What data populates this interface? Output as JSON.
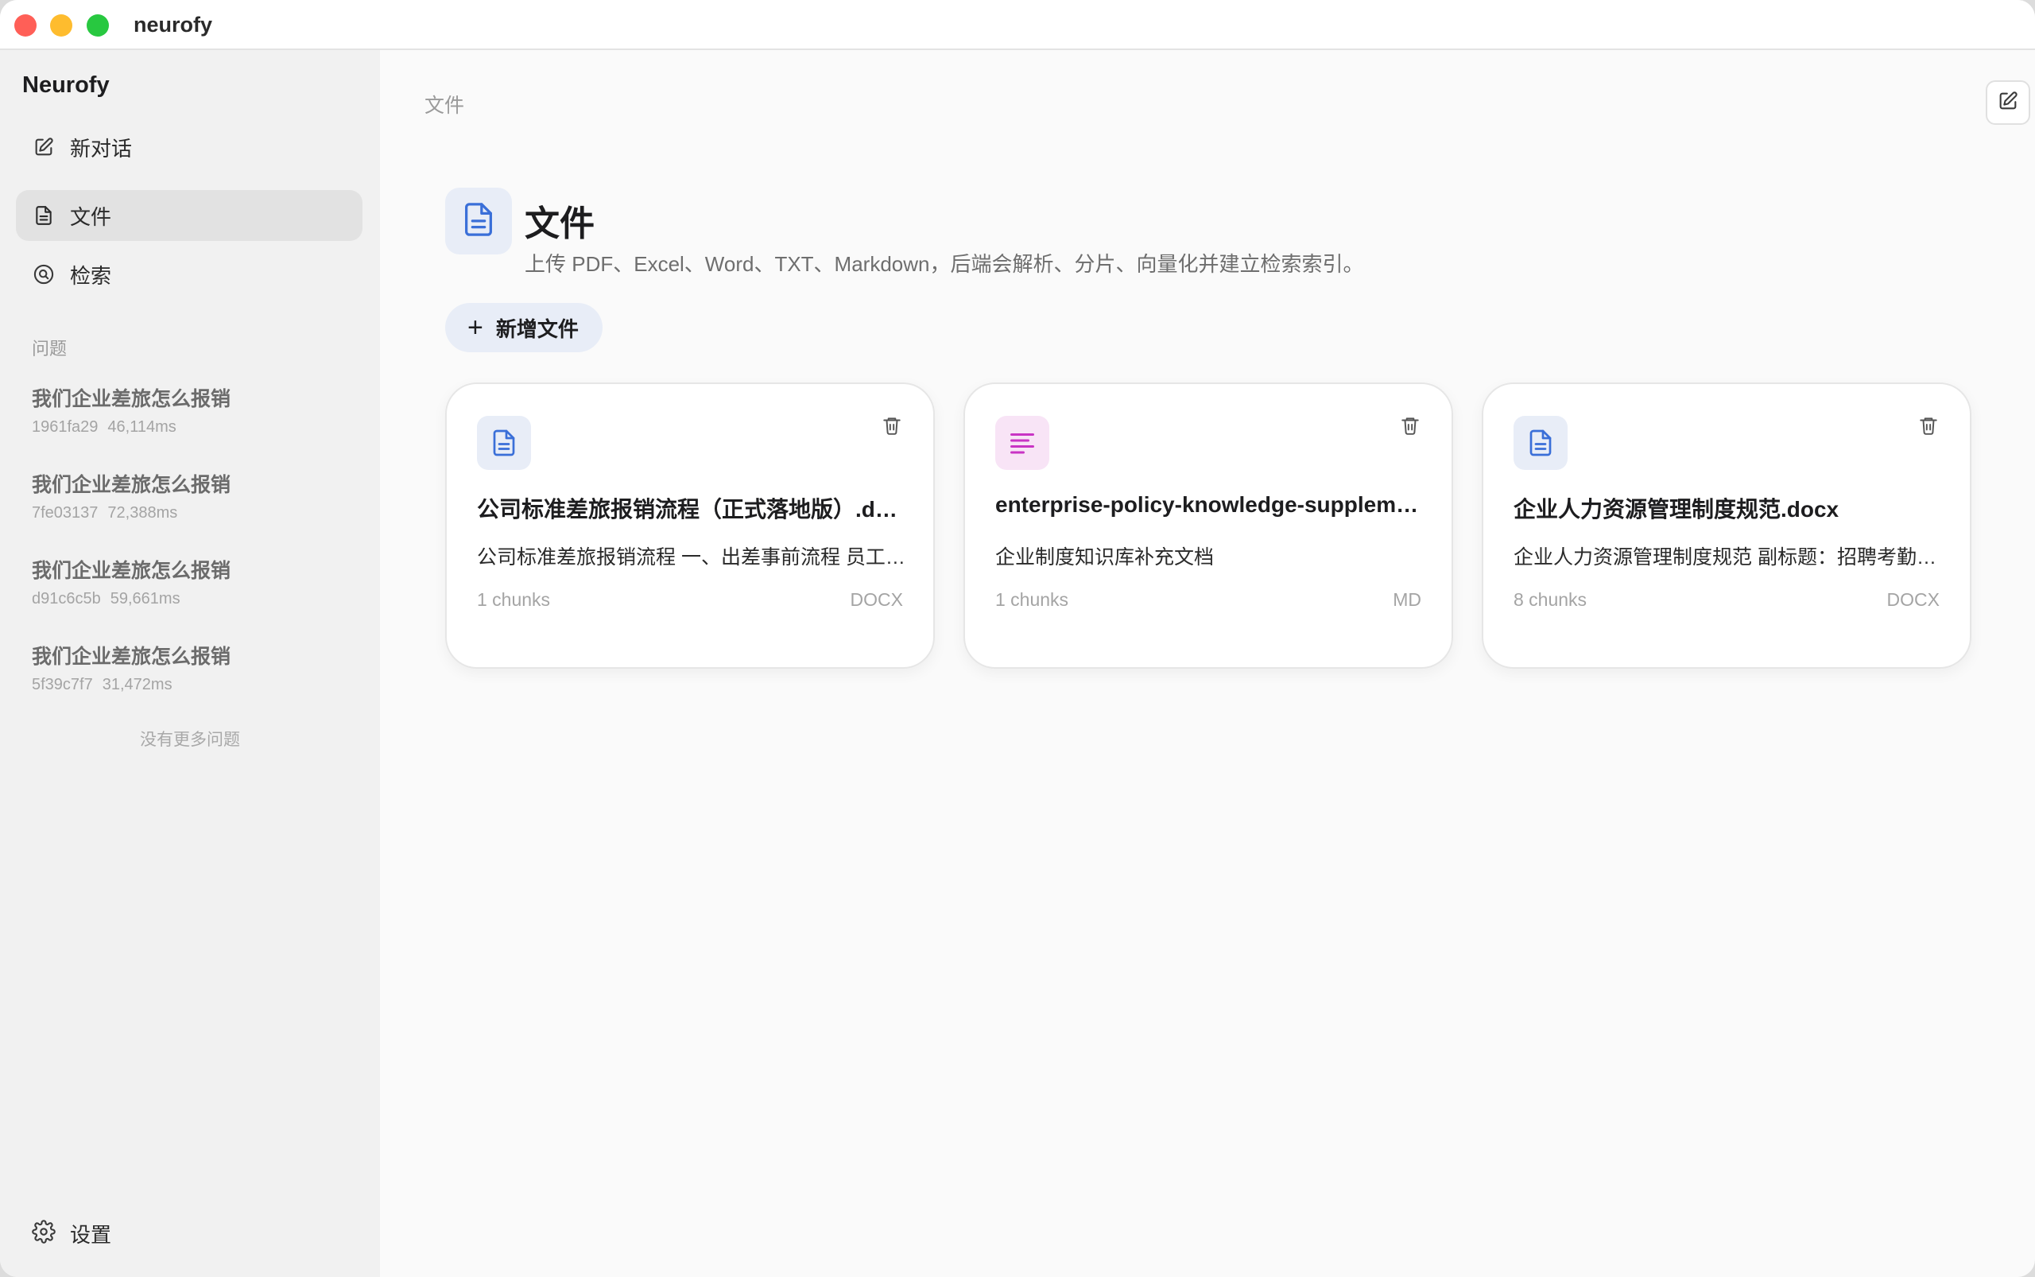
{
  "window": {
    "title": "neurofy"
  },
  "sidebar": {
    "brand": "Neurofy",
    "nav": [
      {
        "label": "新对话",
        "icon": "compose-icon"
      },
      {
        "label": "文件",
        "icon": "document-icon",
        "active": true
      },
      {
        "label": "检索",
        "icon": "search-icon"
      }
    ],
    "section_label": "问题",
    "questions": [
      {
        "title": "我们企业差旅怎么报销",
        "id": "1961fa29",
        "duration": "46,114ms"
      },
      {
        "title": "我们企业差旅怎么报销",
        "id": "7fe03137",
        "duration": "72,388ms"
      },
      {
        "title": "我们企业差旅怎么报销",
        "id": "d91c6c5b",
        "duration": "59,661ms"
      },
      {
        "title": "我们企业差旅怎么报销",
        "id": "5f39c7f7",
        "duration": "31,472ms"
      }
    ],
    "no_more": "没有更多问题",
    "settings_label": "设置"
  },
  "main": {
    "breadcrumb": "文件",
    "title": "文件",
    "subtitle": "上传 PDF、Excel、Word、TXT、Markdown，后端会解析、分片、向量化并建立检索索引。",
    "add_button": "新增文件",
    "files": [
      {
        "name": "公司标准差旅报销流程（正式落地版）.docx",
        "preview": "公司标准差旅报销流程 一、出差事前流程 员工出差前需提交出差申请",
        "chunks": "1 chunks",
        "type": "DOCX",
        "icon": "document-icon"
      },
      {
        "name": "enterprise-policy-knowledge-supplement.md",
        "preview": "企业制度知识库补充文档",
        "chunks": "1 chunks",
        "type": "MD",
        "icon": "text-lines-icon"
      },
      {
        "name": "企业人力资源管理制度规范.docx",
        "preview": "企业人力资源管理制度规范 副标题：招聘考勤与绩效管理",
        "chunks": "8 chunks",
        "type": "DOCX",
        "icon": "document-icon"
      }
    ]
  },
  "colors": {
    "accent_blue": "#3a6fd8",
    "accent_magenta": "#c934c4",
    "sidebar_bg": "#f1f1f1",
    "main_bg": "#fafafa"
  }
}
